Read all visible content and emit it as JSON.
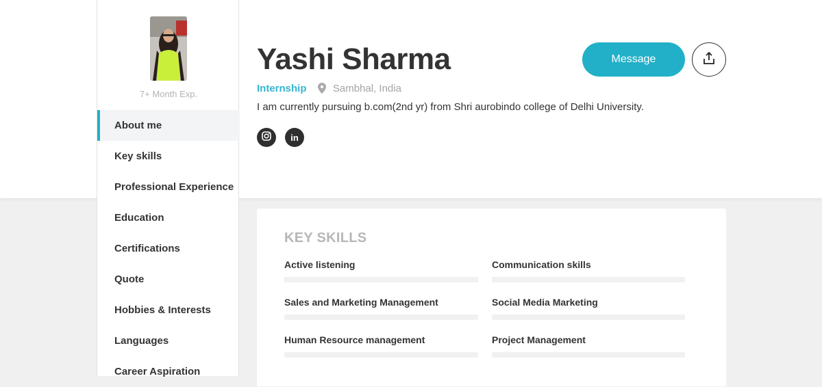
{
  "sidebar": {
    "experience": "7+ Month Exp.",
    "nav": [
      {
        "label": "About me",
        "active": true
      },
      {
        "label": "Key skills"
      },
      {
        "label": "Professional Experience"
      },
      {
        "label": "Education"
      },
      {
        "label": "Certifications"
      },
      {
        "label": "Quote"
      },
      {
        "label": "Hobbies & Interests"
      },
      {
        "label": "Languages"
      },
      {
        "label": "Career Aspiration"
      }
    ]
  },
  "profile": {
    "name": "Yashi Sharma",
    "type": "Internship",
    "location": "Sambhal, India",
    "bio": "I am currently pursuing b.com(2nd yr) from Shri aurobindo college of Delhi University.",
    "socials": [
      {
        "icon": "instagram-icon"
      },
      {
        "icon": "linkedin-icon",
        "glyph": "in"
      }
    ]
  },
  "actions": {
    "message_label": "Message",
    "share_icon": "share-icon"
  },
  "key_skills": {
    "title": "KEY SKILLS",
    "items": [
      "Active listening",
      "Communication skills",
      "Sales and Marketing Management",
      "Social Media Marketing",
      "Human Resource management",
      "Project Management"
    ]
  },
  "colors": {
    "accent": "#21b0c8",
    "type_text": "#36b6cd",
    "muted": "#a4a4a4",
    "page_bg": "#f0f0f0"
  }
}
